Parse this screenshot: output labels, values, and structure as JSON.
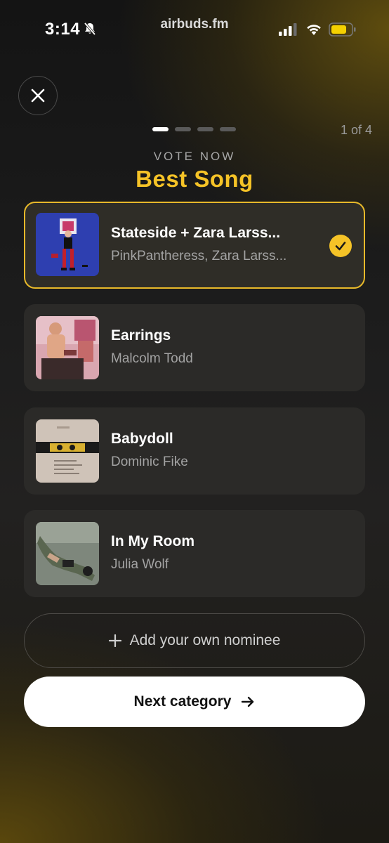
{
  "status_bar": {
    "time": "3:14",
    "url": "airbuds.fm",
    "icons": [
      "bell-slash-icon",
      "signal-icon",
      "wifi-icon",
      "battery-icon"
    ]
  },
  "header": {
    "close_icon": "close-icon",
    "progress": {
      "current": 1,
      "total": 4
    },
    "counter_text": "1 of 4",
    "eyebrow": "VOTE NOW",
    "title": "Best Song"
  },
  "nominees": [
    {
      "title": "Stateside + Zara Larss...",
      "artist": "PinkPantheress, Zara Larss...",
      "selected": true
    },
    {
      "title": "Earrings",
      "artist": "Malcolm Todd",
      "selected": false
    },
    {
      "title": "Babydoll",
      "artist": "Dominic Fike",
      "selected": false
    },
    {
      "title": "In My Room",
      "artist": "Julia Wolf",
      "selected": false
    }
  ],
  "actions": {
    "add_label": "Add your own nominee",
    "next_label": "Next category"
  },
  "colors": {
    "accent": "#f5c327",
    "card": "#2b2a28",
    "muted_text": "#a3a3a3"
  }
}
